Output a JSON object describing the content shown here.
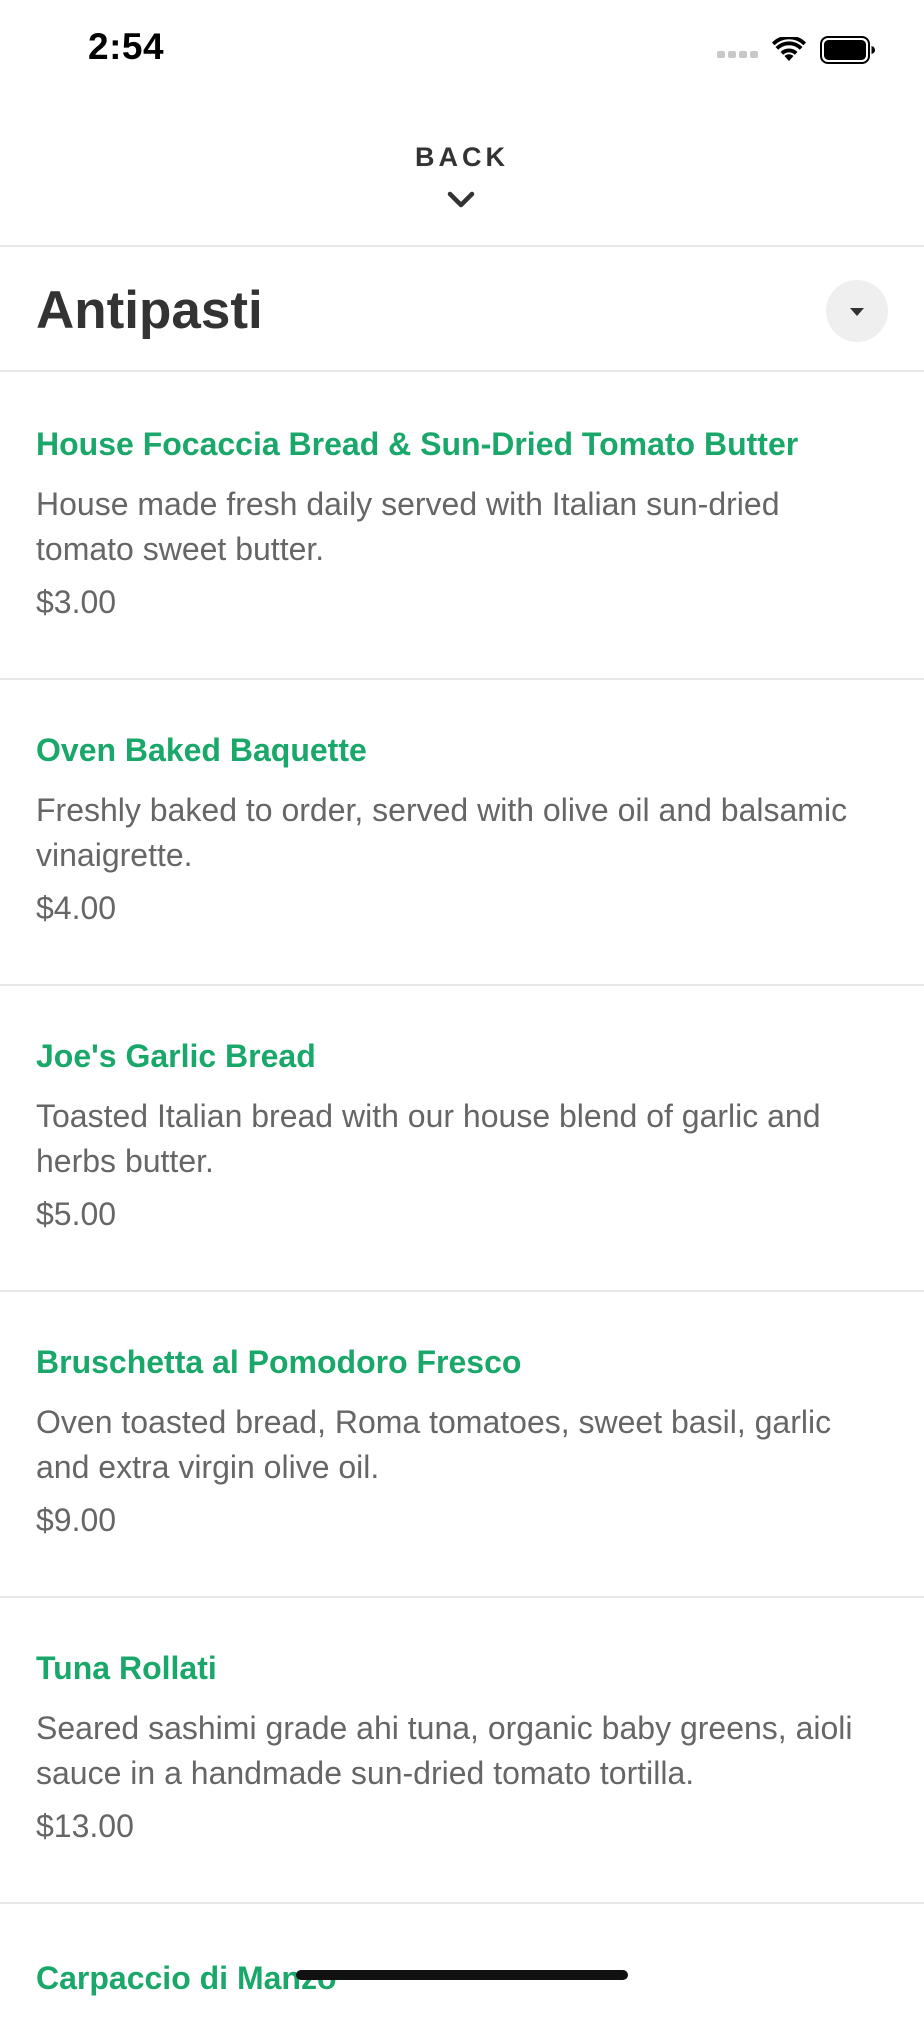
{
  "status_bar": {
    "time": "2:54",
    "icons": [
      "signal-dots-icon",
      "wifi-icon",
      "battery-icon"
    ]
  },
  "header": {
    "back_label": "BACK",
    "back_icon": "chevron-down-icon"
  },
  "section": {
    "title": "Antipasti",
    "toggle_icon": "caret-down-icon"
  },
  "colors": {
    "accent": "#1aa86a",
    "text_primary": "#333333",
    "text_secondary": "#666666",
    "divider": "#e8e8e8"
  },
  "menu_items": [
    {
      "name": "House Focaccia Bread & Sun-Dried Tomato Butter",
      "description": "House made fresh daily served with Italian sun-dried tomato sweet butter.",
      "price": "$3.00"
    },
    {
      "name": "Oven Baked Baquette",
      "description": "Freshly baked to order, served with olive oil and balsamic vinaigrette.",
      "price": "$4.00"
    },
    {
      "name": "Joe's Garlic Bread",
      "description": "Toasted Italian bread with our house blend of garlic and herbs butter.",
      "price": "$5.00"
    },
    {
      "name": "Bruschetta al Pomodoro Fresco",
      "description": "Oven toasted bread, Roma tomatoes, sweet basil, garlic and extra virgin olive oil.",
      "price": "$9.00"
    },
    {
      "name": "Tuna Rollati",
      "description": "Seared sashimi grade ahi tuna, organic baby greens, aioli sauce in a handmade sun-dried tomato tortilla.",
      "price": "$13.00"
    },
    {
      "name": "Carpaccio di Manzo"
    }
  ]
}
